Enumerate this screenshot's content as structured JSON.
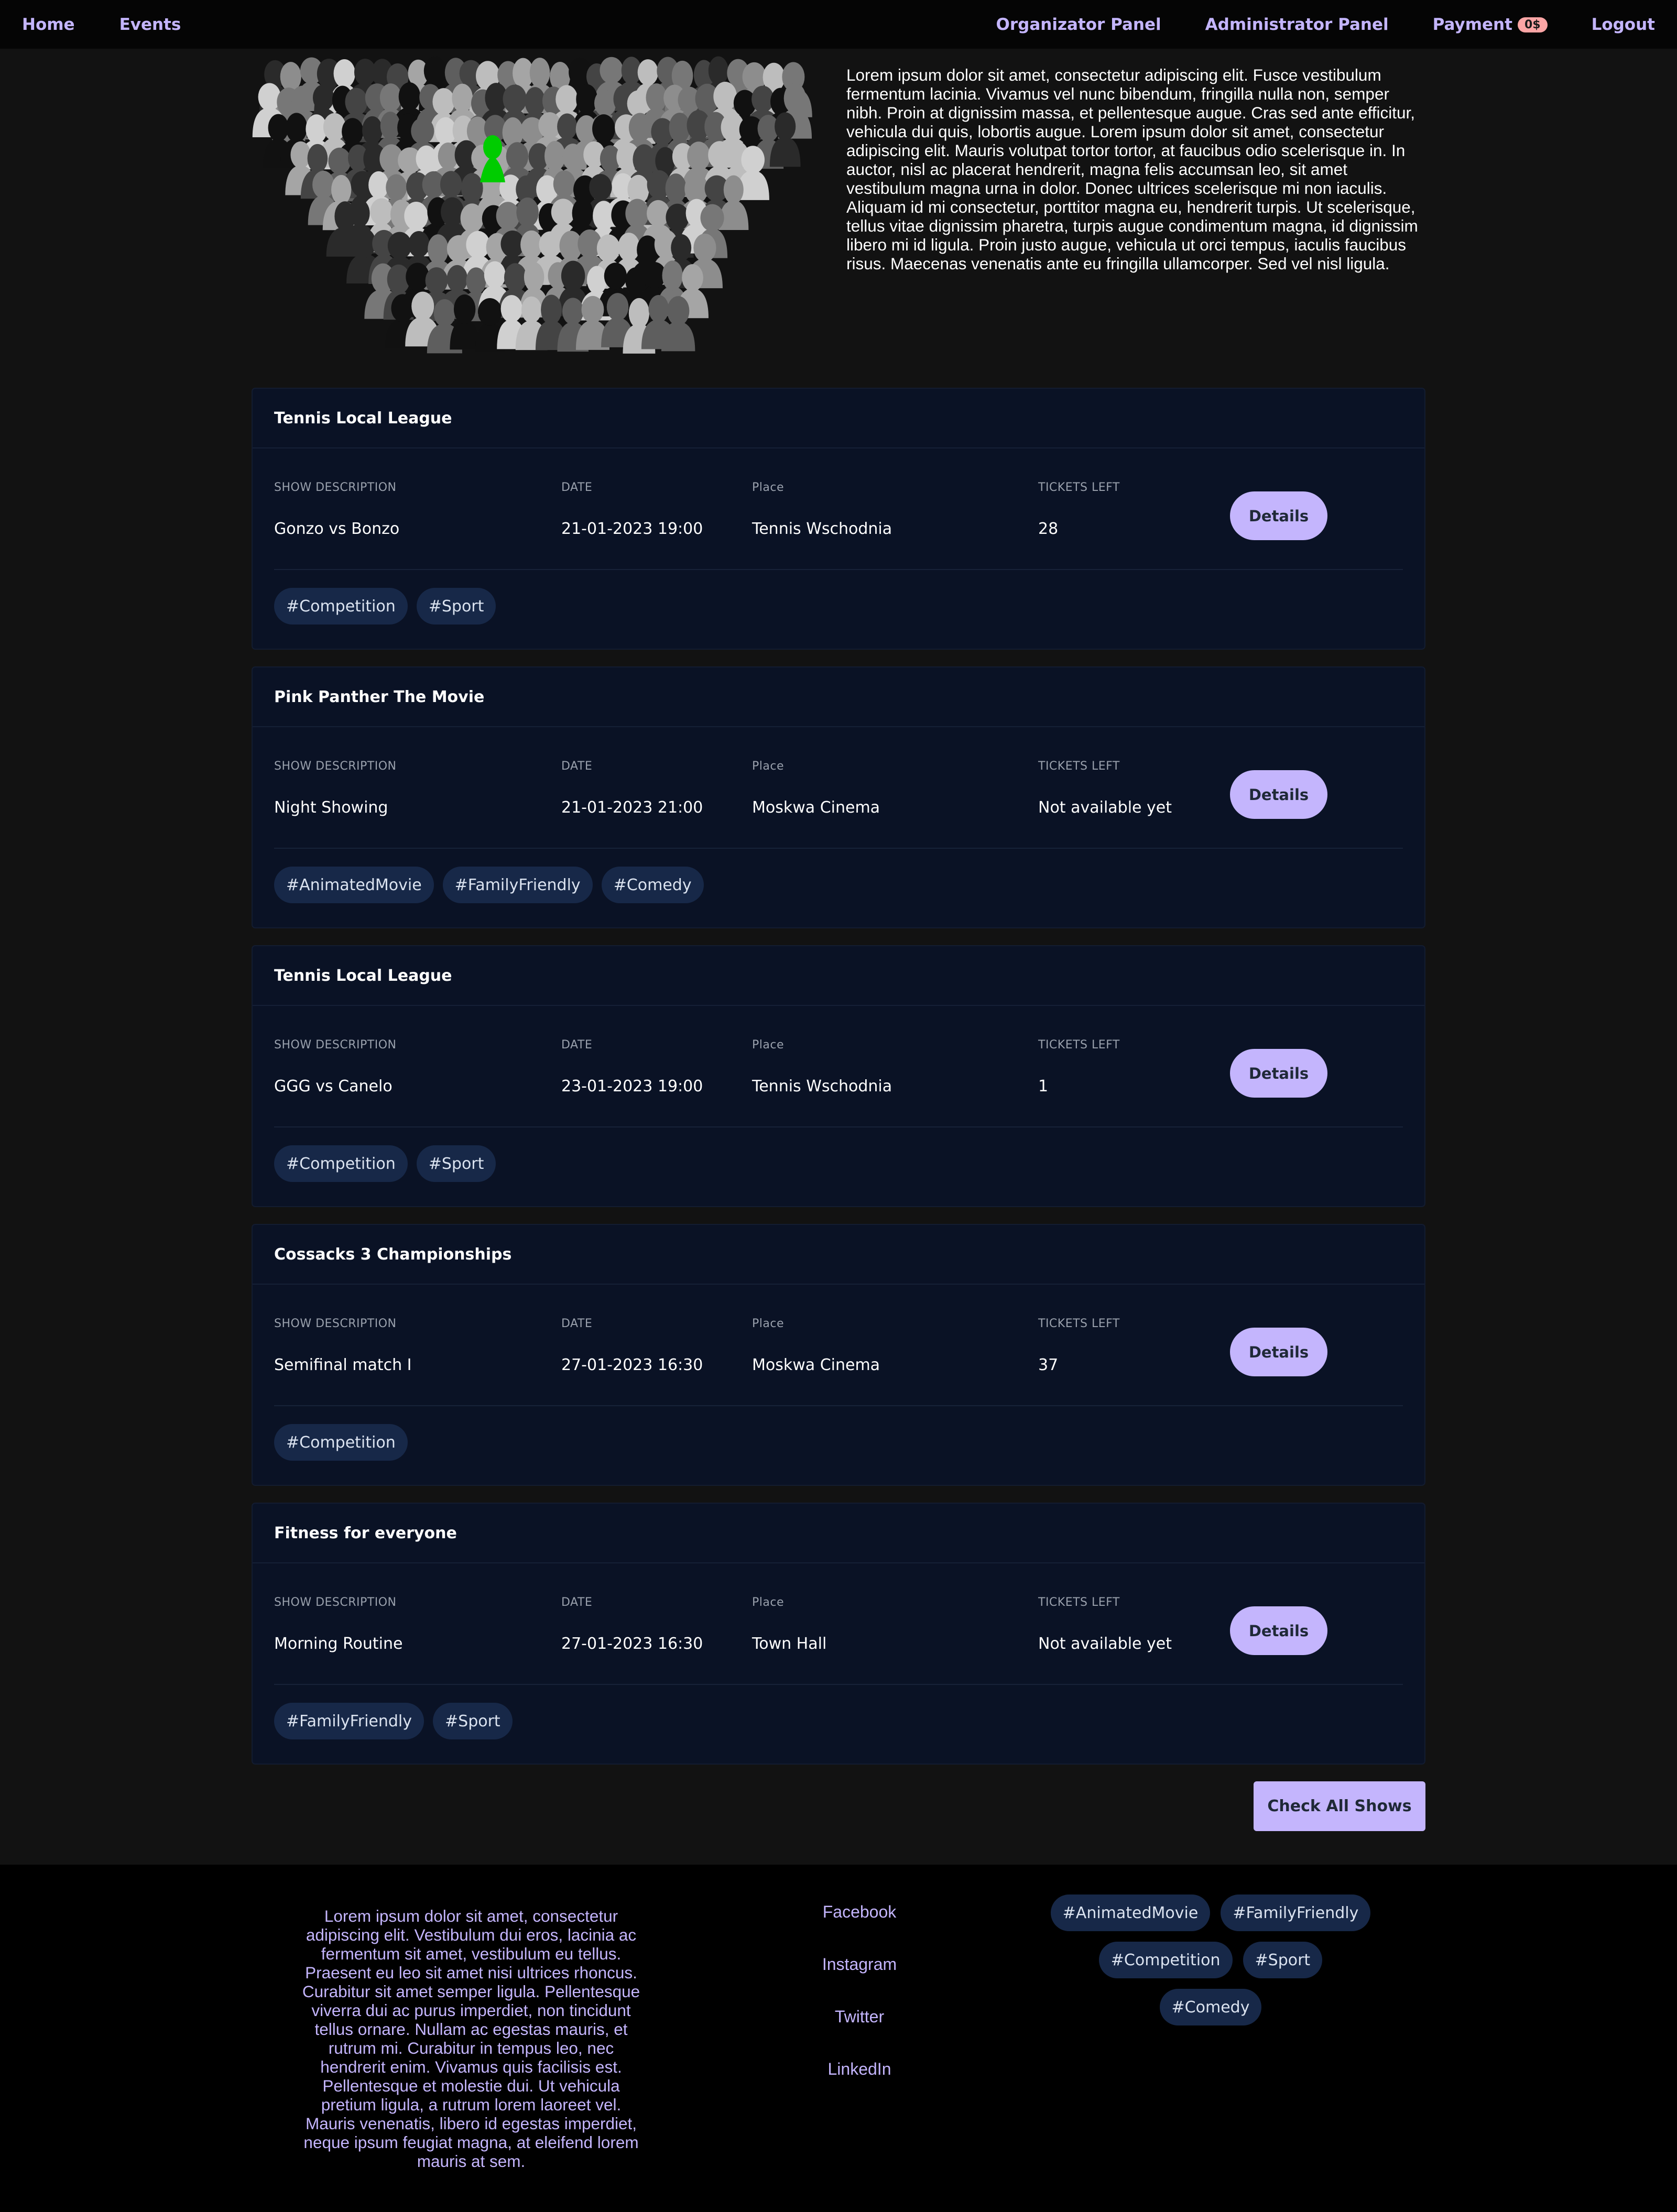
{
  "nav": {
    "home": "Home",
    "events": "Events",
    "organizator": "Organizator Panel",
    "administrator": "Administrator Panel",
    "payment": "Payment",
    "payment_badge": "0$",
    "logout": "Logout"
  },
  "hero": {
    "text": "Lorem ipsum dolor sit amet, consectetur adipiscing elit. Fusce vestibulum fermentum lacinia. Vivamus vel nunc bibendum, fringilla nulla non, semper nibh. Proin at dignissim massa, et pellentesque augue. Cras sed ante efficitur, vehicula dui quis, lobortis augue. Lorem ipsum dolor sit amet, consectetur adipiscing elit. Mauris volutpat tortor tortor, at faucibus odio scelerisque in. In auctor, nisl ac placerat hendrerit, magna felis accumsan leo, sit amet vestibulum magna urna in dolor. Donec ultrices scelerisque mi non iaculis. Aliquam id mi consectetur, porttitor magna eu, hendrerit turpis. Ut scelerisque, tellus vitae dignissim pharetra, turpis augue condimentum magna, id dignissim libero mi id ligula. Proin justo augue, vehicula ut orci tempus, iaculis faucibus risus. Maecenas venenatis ante eu fringilla ullamcorper. Sed vel nisl ligula."
  },
  "labels": {
    "description": "SHOW DESCRIPTION",
    "date": "DATE",
    "place": "Place",
    "tickets": "TICKETS LEFT",
    "details": "Details"
  },
  "events": [
    {
      "title": "Tennis Local League",
      "description": "Gonzo vs Bonzo",
      "date": "21-01-2023 19:00",
      "place": "Tennis Wschodnia",
      "tickets": "28",
      "tags": [
        "#Competition",
        "#Sport"
      ]
    },
    {
      "title": "Pink Panther The Movie",
      "description": "Night Showing",
      "date": "21-01-2023 21:00",
      "place": "Moskwa Cinema",
      "tickets": "Not available yet",
      "tags": [
        "#AnimatedMovie",
        "#FamilyFriendly",
        "#Comedy"
      ]
    },
    {
      "title": "Tennis Local League",
      "description": "GGG vs Canelo",
      "date": "23-01-2023 19:00",
      "place": "Tennis Wschodnia",
      "tickets": "1",
      "tags": [
        "#Competition",
        "#Sport"
      ]
    },
    {
      "title": "Cossacks 3 Championships",
      "description": "Semifinal match I",
      "date": "27-01-2023 16:30",
      "place": "Moskwa Cinema",
      "tickets": "37",
      "tags": [
        "#Competition"
      ]
    },
    {
      "title": "Fitness for everyone",
      "description": "Morning Routine",
      "date": "27-01-2023 16:30",
      "place": "Town Hall",
      "tickets": "Not available yet",
      "tags": [
        "#FamilyFriendly",
        "#Sport"
      ]
    }
  ],
  "check_all_label": "Check All Shows",
  "footer": {
    "text": "Lorem ipsum dolor sit amet, consectetur adipiscing elit. Vestibulum dui eros, lacinia ac fermentum sit amet, vestibulum eu tellus. Praesent eu leo sit amet nisi ultrices rhoncus. Curabitur sit amet semper ligula. Pellentesque viverra dui ac purus imperdiet, non tincidunt tellus ornare. Nullam ac egestas mauris, et rutrum mi. Curabitur in tempus leo, nec hendrerit enim. Vivamus quis facilisis est. Pellentesque et molestie dui. Ut vehicula pretium ligula, a rutrum lorem laoreet vel. Mauris venenatis, libero id egestas imperdiet, neque ipsum feugiat magna, at eleifend lorem mauris at sem.",
    "links": [
      "Facebook",
      "Instagram",
      "Twitter",
      "LinkedIn"
    ],
    "tags": [
      "#AnimatedMovie",
      "#FamilyFriendly",
      "#Competition",
      "#Sport",
      "#Comedy"
    ]
  },
  "colors": {
    "accent": "#c4b5fd",
    "card_bg": "#0a1225",
    "tag_bg": "#172848",
    "badge": "#fca5a5",
    "highlight_person": "#00cc00"
  }
}
